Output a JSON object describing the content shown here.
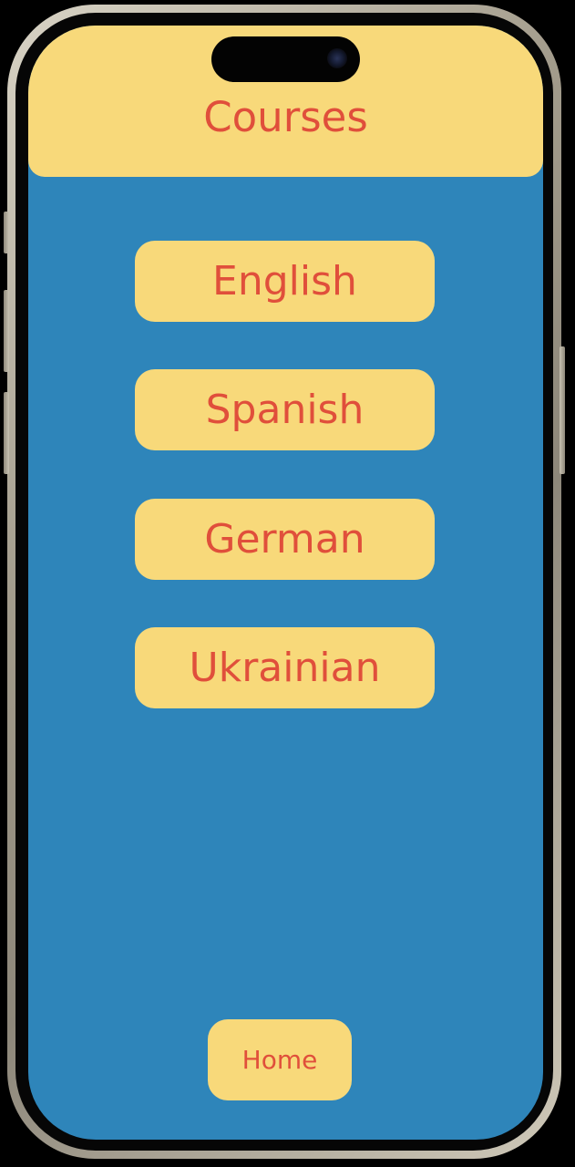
{
  "header": {
    "title": "Courses"
  },
  "courses": [
    {
      "label": "English"
    },
    {
      "label": "Spanish"
    },
    {
      "label": "German"
    },
    {
      "label": "Ukrainian"
    }
  ],
  "footer": {
    "home_label": "Home"
  },
  "colors": {
    "background": "#2e85ba",
    "header": "#f8d97a",
    "button": "#f8d97a",
    "text": "#e04f3b"
  }
}
